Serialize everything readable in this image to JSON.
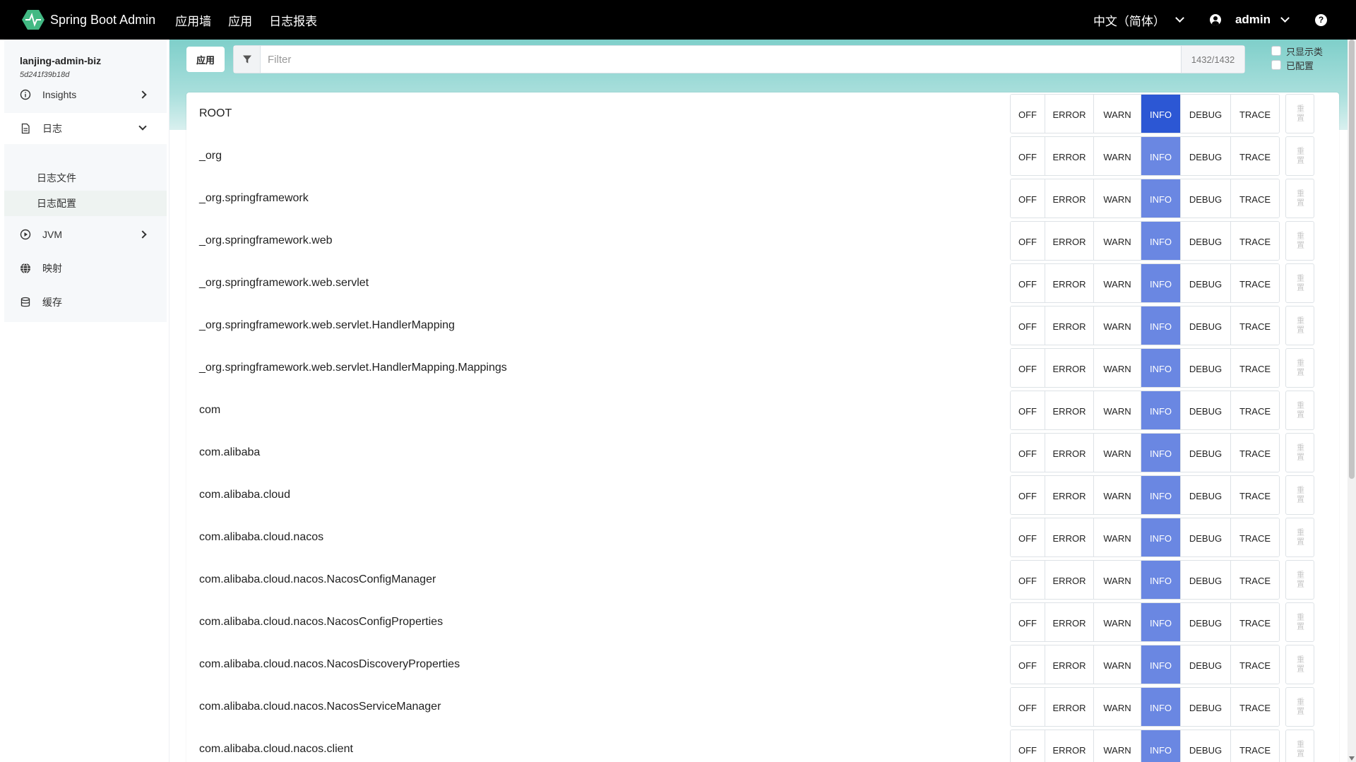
{
  "topbar": {
    "brand": "Spring Boot Admin",
    "nav": [
      "应用墙",
      "应用",
      "日志报表"
    ],
    "language": "中文（简体）",
    "user": "admin",
    "help": "?"
  },
  "sidebar": {
    "app_name": "lanjing-admin-biz",
    "app_id": "5d241f39b18d",
    "items": [
      {
        "label": "Insights",
        "icon": "info-circle-icon"
      },
      {
        "label": "日志",
        "icon": "file-text-icon"
      },
      {
        "label": "JVM",
        "icon": "play-circle-icon"
      },
      {
        "label": "映射",
        "icon": "globe-icon"
      },
      {
        "label": "缓存",
        "icon": "database-icon"
      }
    ],
    "sub_items": [
      {
        "label": "日志文件"
      },
      {
        "label": "日志配置"
      }
    ]
  },
  "filter": {
    "tag": "应用",
    "placeholder": "Filter",
    "value": "",
    "count": "1432/1432",
    "options": [
      "只显示类",
      "已配置"
    ]
  },
  "levels": [
    "OFF",
    "ERROR",
    "WARN",
    "INFO",
    "DEBUG",
    "TRACE"
  ],
  "reset_label": "重置",
  "loggers": [
    {
      "name": "ROOT",
      "level": "INFO"
    },
    {
      "name": "_org",
      "level": "INFO"
    },
    {
      "name": "_org.springframework",
      "level": "INFO"
    },
    {
      "name": "_org.springframework.web",
      "level": "INFO"
    },
    {
      "name": "_org.springframework.web.servlet",
      "level": "INFO"
    },
    {
      "name": "_org.springframework.web.servlet.HandlerMapping",
      "level": "INFO"
    },
    {
      "name": "_org.springframework.web.servlet.HandlerMapping.Mappings",
      "level": "INFO"
    },
    {
      "name": "com",
      "level": "INFO"
    },
    {
      "name": "com.alibaba",
      "level": "INFO"
    },
    {
      "name": "com.alibaba.cloud",
      "level": "INFO"
    },
    {
      "name": "com.alibaba.cloud.nacos",
      "level": "INFO"
    },
    {
      "name": "com.alibaba.cloud.nacos.NacosConfigManager",
      "level": "INFO"
    },
    {
      "name": "com.alibaba.cloud.nacos.NacosConfigProperties",
      "level": "INFO"
    },
    {
      "name": "com.alibaba.cloud.nacos.NacosDiscoveryProperties",
      "level": "INFO"
    },
    {
      "name": "com.alibaba.cloud.nacos.NacosServiceManager",
      "level": "INFO"
    },
    {
      "name": "com.alibaba.cloud.nacos.client",
      "level": "INFO"
    }
  ],
  "colors": {
    "topbar": "#000000",
    "info_active": "#6a87e2",
    "info_root": "#2c57d4",
    "band": "#7fcfca"
  }
}
